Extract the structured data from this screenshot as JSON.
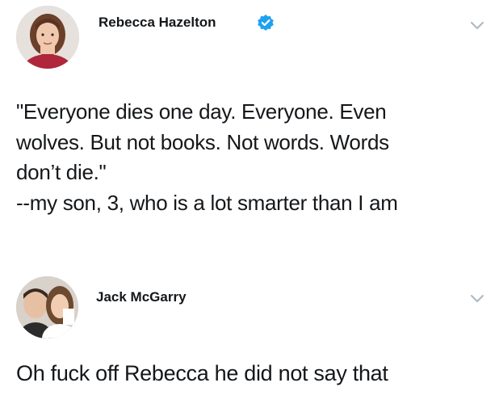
{
  "tweets": [
    {
      "author": "Rebecca Hazelton",
      "verified": true,
      "icons": {
        "avatar": "avatar-photo",
        "verified": "verified-badge-icon",
        "menu": "chevron-down-icon"
      },
      "lines": [
        "\"Everyone dies one day. Everyone. Even",
        "wolves. But not books. Not words. Words",
        "don’t die.\"",
        "--my son, 3, who is a lot smarter than I am"
      ]
    },
    {
      "author": "Jack McGarry",
      "verified": false,
      "icons": {
        "avatar": "avatar-photo",
        "menu": "chevron-down-icon"
      },
      "lines": [
        "Oh fuck off Rebecca he did not say that"
      ]
    }
  ],
  "colors": {
    "text": "#14171a",
    "verified_blue": "#1da1f2",
    "chevron": "#aab8c2"
  }
}
